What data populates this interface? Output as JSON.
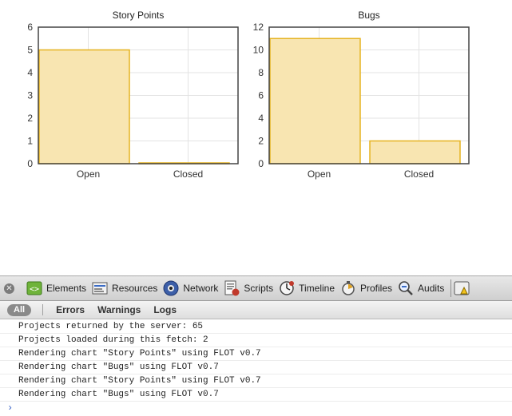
{
  "charts": [
    {
      "type": "bar",
      "title": "Story Points",
      "categories": [
        "Open",
        "Closed"
      ],
      "values": [
        5,
        0
      ],
      "yticks": [
        0,
        1,
        2,
        3,
        4,
        5,
        6
      ],
      "ylim": [
        0,
        6
      ],
      "grid": true
    },
    {
      "type": "bar",
      "title": "Bugs",
      "categories": [
        "Open",
        "Closed"
      ],
      "values": [
        11,
        2
      ],
      "yticks": [
        0,
        2,
        4,
        6,
        8,
        10,
        12
      ],
      "ylim": [
        0,
        12
      ],
      "grid": true
    }
  ],
  "chart_colors": {
    "bar_fill": "#f8e5b1",
    "bar_stroke": "#e6b320",
    "axis": "#444444",
    "grid": "#e3e3e3"
  },
  "devtools": {
    "close_icon": "close-icon",
    "tabs": [
      {
        "label": "Elements",
        "icon": "elements-icon"
      },
      {
        "label": "Resources",
        "icon": "resources-icon"
      },
      {
        "label": "Network",
        "icon": "network-icon"
      },
      {
        "label": "Scripts",
        "icon": "scripts-icon"
      },
      {
        "label": "Timeline",
        "icon": "timeline-icon"
      },
      {
        "label": "Profiles",
        "icon": "profiles-icon"
      },
      {
        "label": "Audits",
        "icon": "audits-icon"
      }
    ]
  },
  "console": {
    "filters": [
      "All",
      "Errors",
      "Warnings",
      "Logs"
    ],
    "active_filter": "All",
    "lines": [
      "Projects returned by the server: 65",
      "Projects loaded during this fetch: 2",
      "Rendering chart \"Story Points\" using FLOT v0.7",
      "Rendering chart \"Bugs\" using FLOT v0.7",
      "Rendering chart \"Story Points\" using FLOT v0.7",
      "Rendering chart \"Bugs\" using FLOT v0.7"
    ],
    "prompt": "›"
  }
}
